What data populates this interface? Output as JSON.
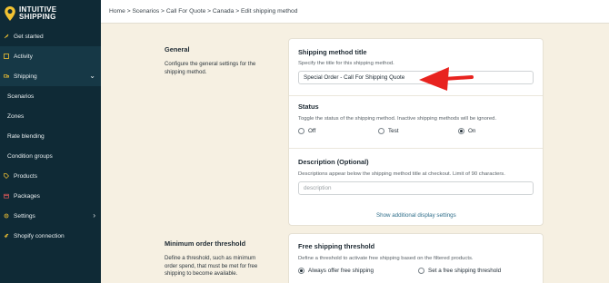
{
  "brand": {
    "line1": "INTUITIVE",
    "line2": "SHIPPING"
  },
  "colors": {
    "sidebar": "#0f2a36",
    "background": "#f6f0e2",
    "accent_yellow": "#f1c232",
    "arrow_red": "#e8231f"
  },
  "sidebar": {
    "items": [
      {
        "label": "Get started",
        "icon": "rocket-icon"
      },
      {
        "label": "Activity",
        "icon": "activity-icon"
      },
      {
        "label": "Shipping",
        "icon": "truck-icon"
      },
      {
        "label": "Scenarios"
      },
      {
        "label": "Zones"
      },
      {
        "label": "Rate blending"
      },
      {
        "label": "Condition groups"
      },
      {
        "label": "Products",
        "icon": "tag-icon"
      },
      {
        "label": "Packages",
        "icon": "package-icon"
      },
      {
        "label": "Settings",
        "icon": "gear-icon"
      },
      {
        "label": "Shopify connection",
        "icon": "link-icon"
      }
    ]
  },
  "breadcrumb": "Home > Scenarios > Call For Quote > Canada > Edit shipping method",
  "general": {
    "title": "General",
    "description": "Configure the general settings for the shipping method."
  },
  "method_title": {
    "title": "Shipping method title",
    "description": "Specify the title for this shipping method.",
    "value": "Special Order - Call For Shipping Quote"
  },
  "status": {
    "title": "Status",
    "description": "Toggle the status of the shipping method. Inactive shipping methods will be ignored.",
    "options": [
      "Off",
      "Test",
      "On"
    ],
    "selected": "On"
  },
  "description_field": {
    "title": "Description",
    "optional": "(Optional)",
    "description": "Descriptions appear below the shipping method title at checkout. Limit of 90 characters.",
    "placeholder": "description"
  },
  "display_link": "Show additional display settings",
  "min_order": {
    "title": "Minimum order threshold",
    "description": "Define a threshold, such as minimum order spend, that must be met for free shipping to become available."
  },
  "free_shipping": {
    "title": "Free shipping threshold",
    "description": "Define a threshold to activate free shipping based on the filtered products.",
    "options": [
      "Always offer free shipping",
      "Set a free shipping threshold"
    ],
    "selected": "Always offer free shipping"
  }
}
